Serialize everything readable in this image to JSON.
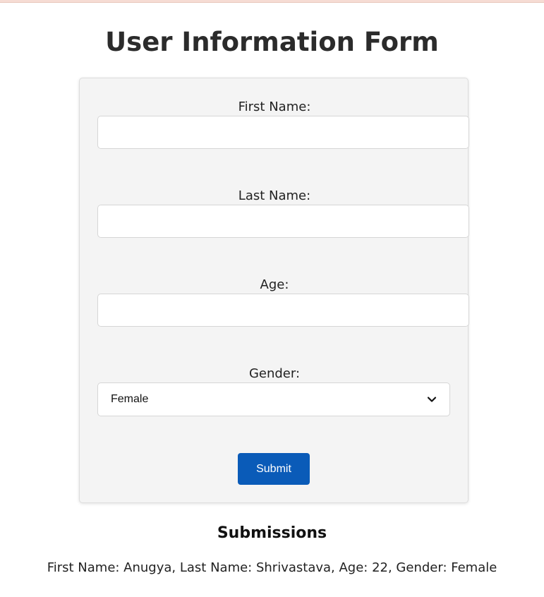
{
  "page": {
    "title": "User Information Form"
  },
  "form": {
    "first_name": {
      "label": "First Name:",
      "value": "",
      "placeholder": ""
    },
    "last_name": {
      "label": "Last Name:",
      "value": "",
      "placeholder": ""
    },
    "age": {
      "label": "Age:",
      "value": "",
      "placeholder": ""
    },
    "gender": {
      "label": "Gender:",
      "selected": "Female"
    },
    "submit_label": "Submit"
  },
  "submissions": {
    "title": "Submissions",
    "entries": [
      "First Name: Anugya, Last Name: Shrivastava, Age: 22, Gender: Female"
    ]
  },
  "colors": {
    "submit_button": "#0a5bb8",
    "card_background": "#f4f4f4",
    "top_strip": "#f6dcd4"
  },
  "icons": {
    "gender_select": "chevron-down-icon"
  }
}
